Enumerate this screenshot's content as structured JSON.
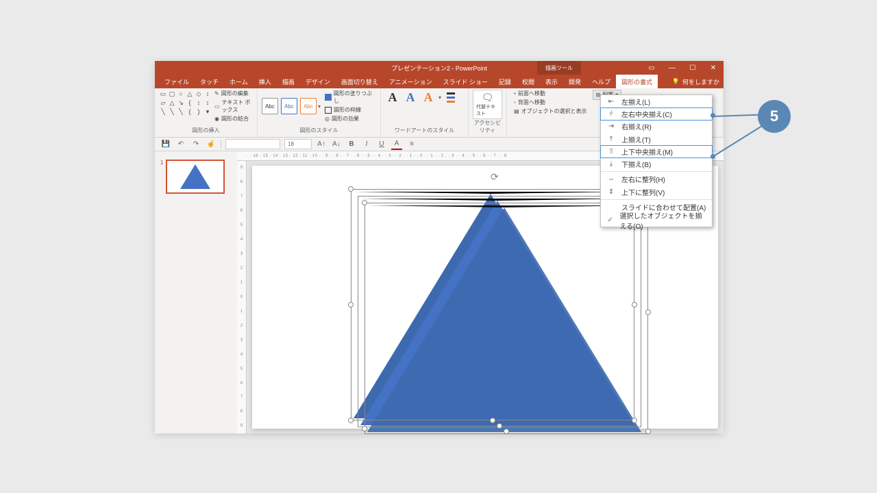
{
  "title": "プレゼンテーション2 - PowerPoint",
  "contextual_tab": "描画ツール",
  "tabs": [
    "ファイル",
    "タッチ",
    "ホーム",
    "挿入",
    "描画",
    "デザイン",
    "画面切り替え",
    "アニメーション",
    "スライド ショー",
    "記録",
    "校閲",
    "表示",
    "開発",
    "ヘルプ",
    "図形の書式"
  ],
  "active_tab": "図形の書式",
  "tell_me": "何をしますか",
  "ribbon": {
    "shape_insert_group": "図形の挿入",
    "shape_edit": "図形の編集",
    "text_box": "テキスト ボックス",
    "shape_merge": "図形の結合",
    "shape_style_group": "図形のスタイル",
    "shape_fill": "図形の塗りつぶし",
    "shape_outline": "図形の枠線",
    "shape_effects": "図形の効果",
    "style_label": "Abc",
    "wordart_group": "ワードアートのスタイル",
    "wordart_a": "A",
    "accessibility": "アクセシビリティ",
    "daitai": "代替テキスト",
    "bring_forward": "前面へ移動",
    "send_backward": "背面へ移動",
    "selection_pane": "オブジェクトの選択と表示",
    "arrange_group": "配置",
    "haichi": "配置"
  },
  "qat": {
    "font_name": "",
    "font_size": "18"
  },
  "thumb_num": "1",
  "h_ruler": "· · 16 · 15 · 14 · 13 · 12 · 11 · 10 · · 9 · · 8 · · 7 · · 6 · · 5 · · 4 · · 3 · · 2 · · 1 · · 0 · · 1 · · 2 · · 3 · · 4 · · 5 · · 6 · · 7 · · 8",
  "v_ruler": [
    "9",
    "8",
    "7",
    "6",
    "5",
    "4",
    "3",
    "2",
    "1",
    "0",
    "1",
    "2",
    "3",
    "4",
    "5",
    "6",
    "7",
    "8",
    "9"
  ],
  "align_menu": {
    "left": "左揃え(L)",
    "center_h": "左右中央揃え(C)",
    "right": "右揃え(R)",
    "top": "上揃え(T)",
    "center_v": "上下中央揃え(M)",
    "bottom": "下揃え(B)",
    "dist_h": "左右に整列(H)",
    "dist_v": "上下に整列(V)",
    "to_slide": "スライドに合わせて配置(A)",
    "to_selected": "選択したオブジェクトを揃える(O)"
  },
  "callout": "5"
}
